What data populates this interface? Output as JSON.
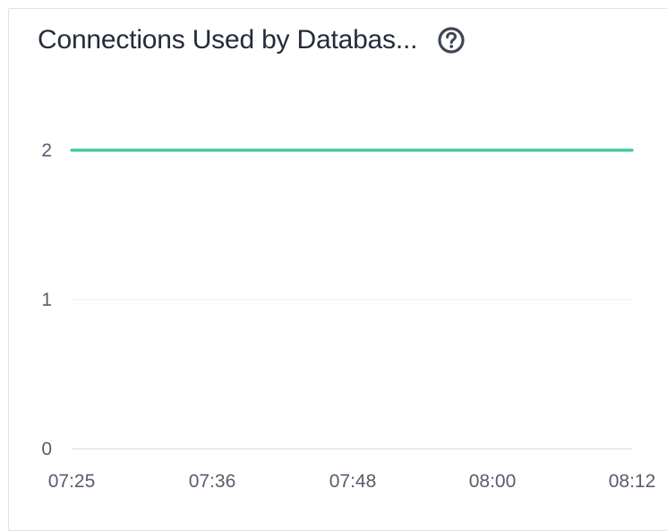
{
  "panel": {
    "title": "Connections Used by Databas...",
    "help_icon": "question-circle-icon"
  },
  "chart_data": {
    "type": "line",
    "title": "Connections Used by Databas...",
    "xlabel": "",
    "ylabel": "",
    "x_ticks": [
      "07:25",
      "07:36",
      "07:48",
      "08:00",
      "08:12"
    ],
    "y_ticks": [
      0,
      1,
      2
    ],
    "ylim": [
      0,
      2
    ],
    "grid": "horizontal",
    "legend": "none",
    "series": [
      {
        "color": "#3cc7a0",
        "points": [
          {
            "x": "07:25",
            "y": 2
          },
          {
            "x": "08:12",
            "y": 2
          }
        ]
      }
    ]
  },
  "colors": {
    "line": "#3cc7a0",
    "grid": "#ececec",
    "axis": "#d9d9d9",
    "text": "#575d6c",
    "title": "#252b3a",
    "card_border": "#e2e2e2"
  }
}
